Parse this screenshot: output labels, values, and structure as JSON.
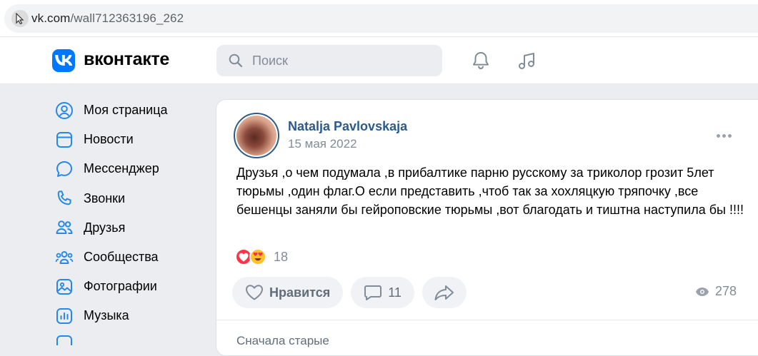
{
  "browser": {
    "url_host": "vk.com",
    "url_path": "/wall712363196_262"
  },
  "header": {
    "brand": "вконтакте",
    "search_placeholder": "Поиск",
    "icons": [
      "bell-icon",
      "music-note-icon"
    ]
  },
  "sidebar": {
    "items": [
      {
        "label": "Моя страница",
        "icon": "user-circle-icon"
      },
      {
        "label": "Новости",
        "icon": "news-feed-icon"
      },
      {
        "label": "Мессенджер",
        "icon": "chat-bubble-icon"
      },
      {
        "label": "Звонки",
        "icon": "phone-icon"
      },
      {
        "label": "Друзья",
        "icon": "friends-icon"
      },
      {
        "label": "Сообщества",
        "icon": "communities-icon"
      },
      {
        "label": "Фотографии",
        "icon": "photo-icon"
      },
      {
        "label": "Музыка",
        "icon": "music-chart-icon"
      }
    ]
  },
  "post": {
    "author": "Natalja Pavlovskaja",
    "date": "15 мая 2022",
    "text": "Друзья ,о чем подумала ,в прибалтике парню русскому за триколор грозит 5лет тюрьмы ,один флаг.О если представить ,чтоб так за хохляцкую тряпочку ,все бешенцы заняли бы гейроповские тюрьмы ,вот благодать и тиштна наступила бы !!!!",
    "reactions_count": "18",
    "like_label": "Нравится",
    "comments_count": "11",
    "views_count": "278",
    "sort_label": "Сначала старые"
  },
  "colors": {
    "accent": "#0077ff",
    "author_link": "#2c5a8c",
    "secondary_text": "#818c99",
    "background": "#ebedf0"
  }
}
